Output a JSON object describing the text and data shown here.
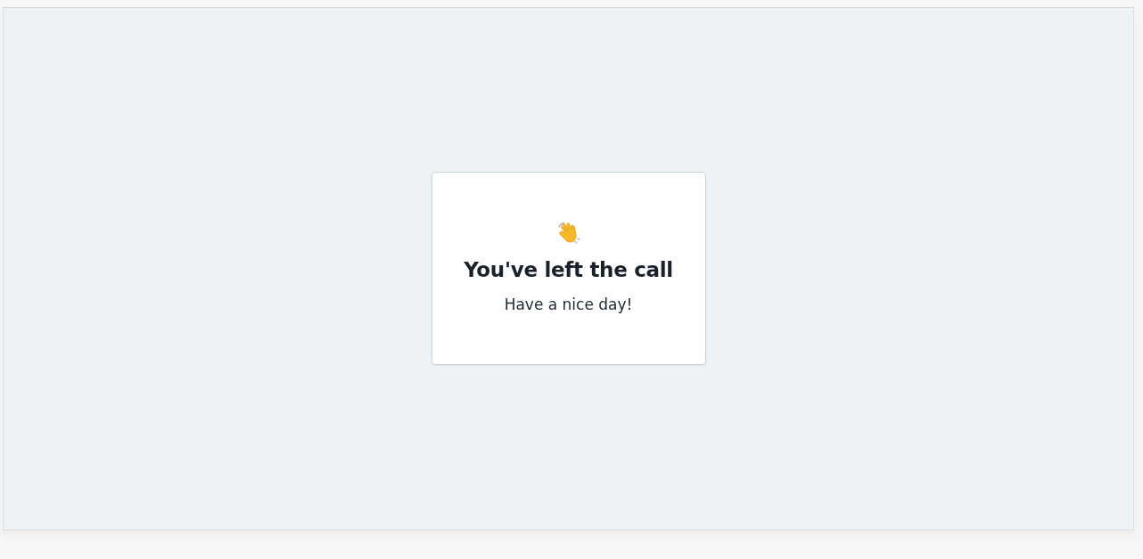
{
  "card": {
    "title": "You've left the call",
    "message": "Have a nice day!"
  }
}
